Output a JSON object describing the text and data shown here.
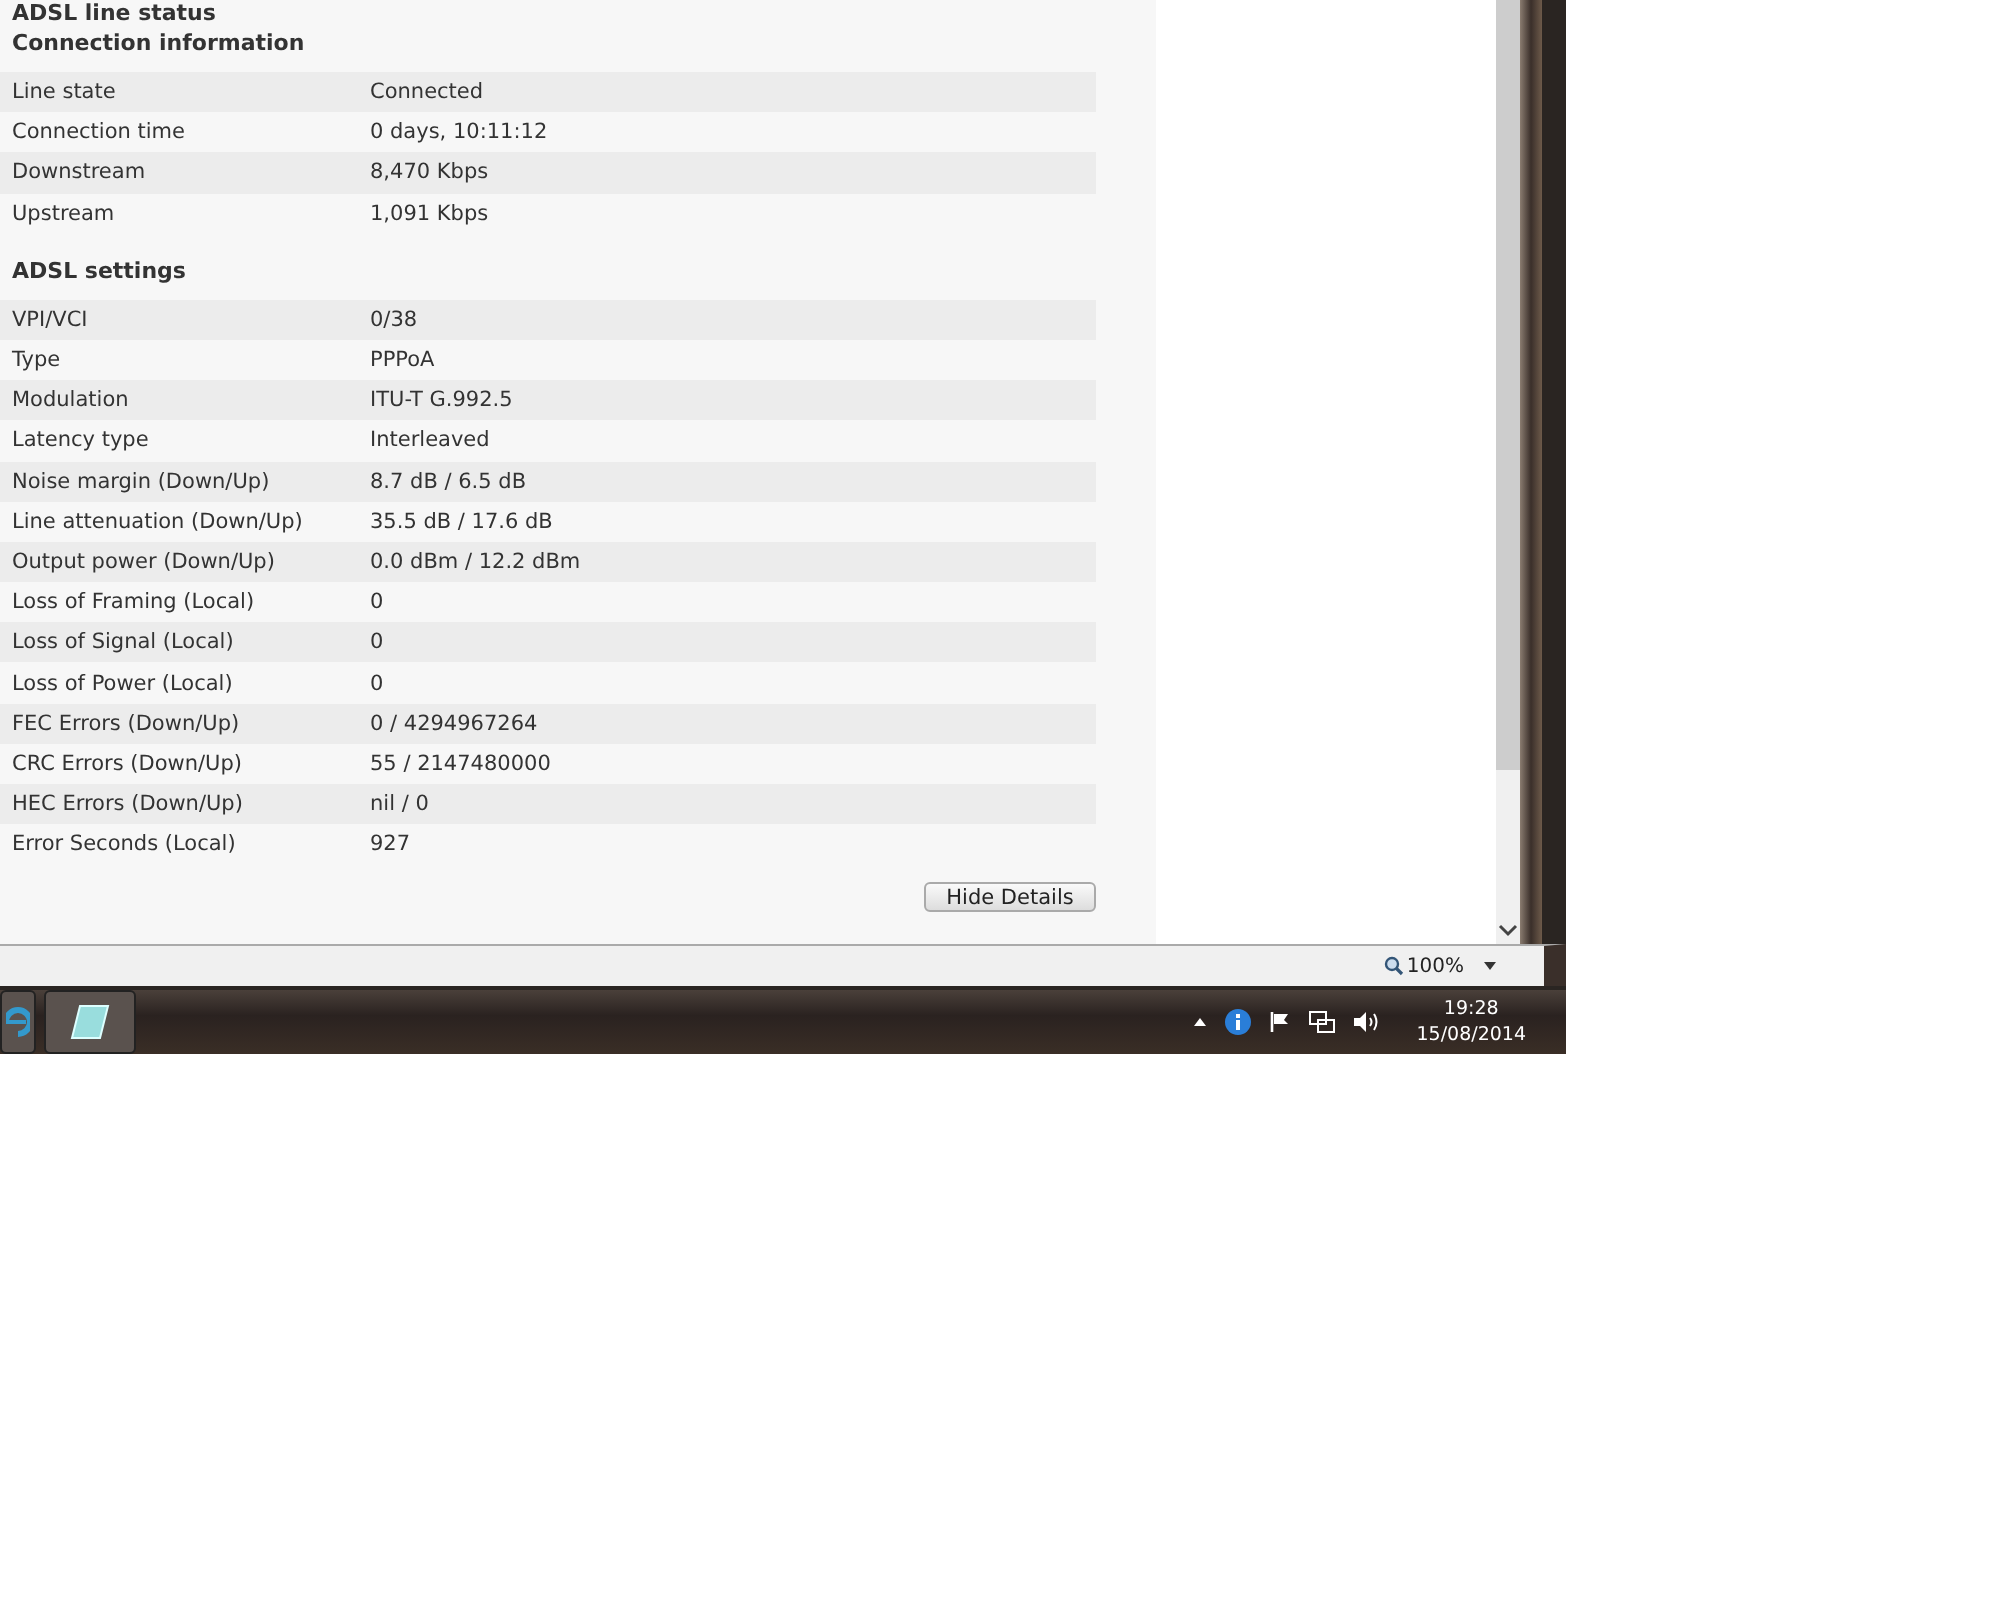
{
  "page_title": "ADSL line status",
  "sections": [
    {
      "heading": "Connection information",
      "rows": [
        {
          "label": "Line state",
          "value": "Connected"
        },
        {
          "label": "Connection time",
          "value": "0 days, 10:11:12"
        },
        {
          "label": "Downstream",
          "value": "8,470 Kbps"
        },
        {
          "label": "Upstream",
          "value": "1,091 Kbps"
        }
      ]
    },
    {
      "heading": "ADSL settings",
      "rows": [
        {
          "label": "VPI/VCI",
          "value": "0/38"
        },
        {
          "label": "Type",
          "value": "PPPoA"
        },
        {
          "label": "Modulation",
          "value": "ITU-T G.992.5"
        },
        {
          "label": "Latency type",
          "value": "Interleaved"
        },
        {
          "label": "Noise margin (Down/Up)",
          "value": "8.7 dB / 6.5 dB"
        },
        {
          "label": "Line attenuation (Down/Up)",
          "value": "35.5 dB / 17.6 dB"
        },
        {
          "label": "Output power (Down/Up)",
          "value": "0.0 dBm / 12.2 dBm"
        },
        {
          "label": "Loss of Framing (Local)",
          "value": "0"
        },
        {
          "label": "Loss of Signal (Local)",
          "value": "0"
        },
        {
          "label": "Loss of Power (Local)",
          "value": "0"
        },
        {
          "label": "FEC Errors (Down/Up)",
          "value": "0 / 4294967264"
        },
        {
          "label": "CRC Errors (Down/Up)",
          "value": "55 / 2147480000"
        },
        {
          "label": "HEC Errors (Down/Up)",
          "value": "nil / 0"
        },
        {
          "label": "Error Seconds (Local)",
          "value": "927"
        }
      ]
    }
  ],
  "button": "Hide Details",
  "status_bar": {
    "zoom": "100%"
  },
  "taskbar": {
    "time": "19:28",
    "date": "15/08/2014"
  }
}
